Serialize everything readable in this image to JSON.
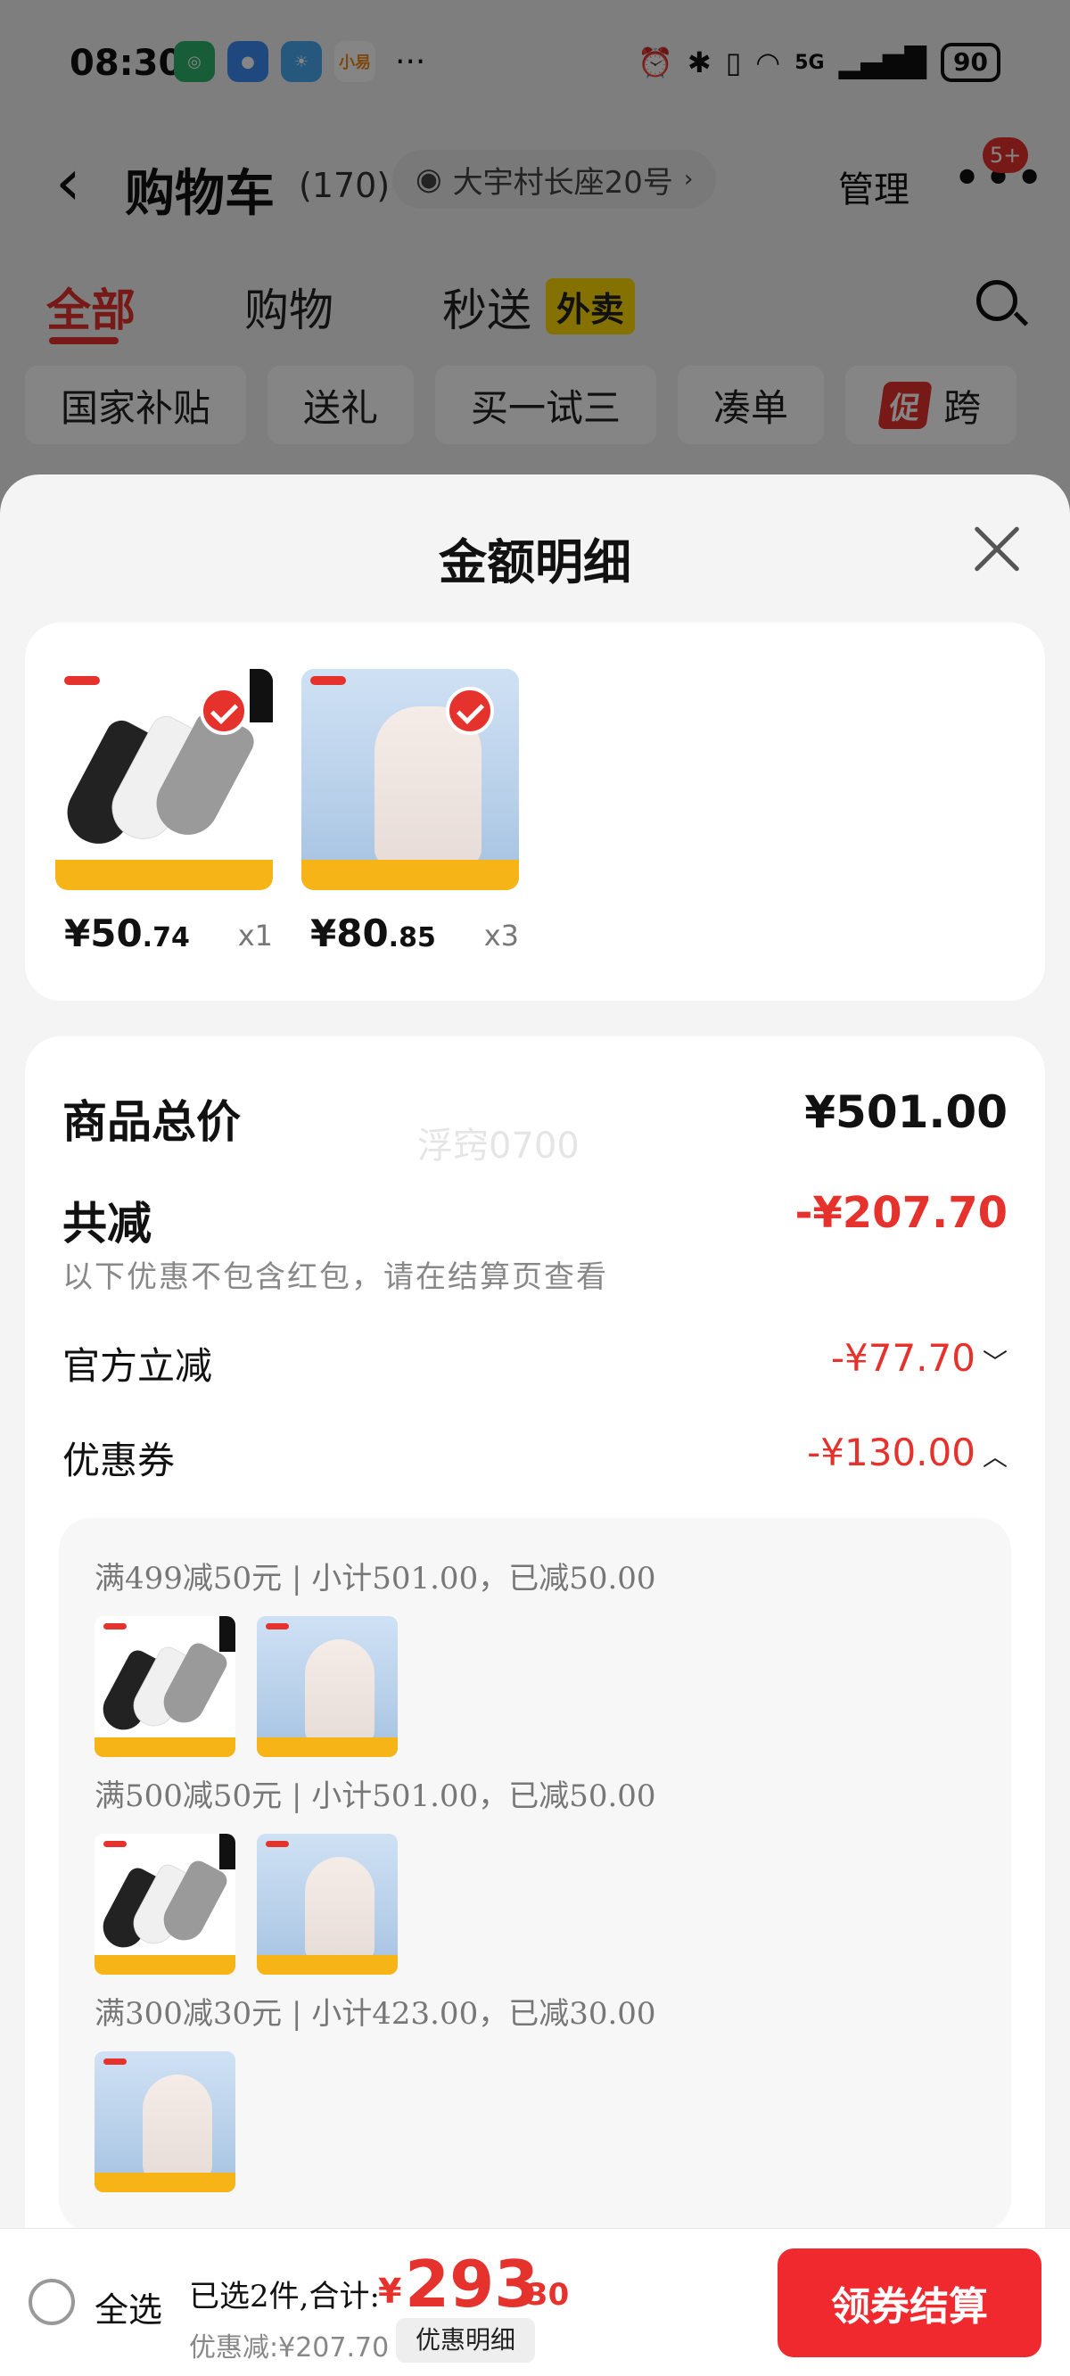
{
  "status_bar": {
    "time": "08:30",
    "app_icons": [
      "mobile-service-icon",
      "messages-icon",
      "weather-icon",
      "xiaoyi-icon"
    ],
    "app_icon_text": "小易",
    "more_dots": "···",
    "network": "5G",
    "battery": "90"
  },
  "nav": {
    "back_icon": "back-chevron-icon",
    "title": "购物车",
    "count": "(170)",
    "address": "大宇村长座20号",
    "manage": "管理",
    "more": "•••",
    "badge": "5+"
  },
  "tabs": [
    {
      "label": "全部",
      "active": true
    },
    {
      "label": "购物",
      "active": false
    },
    {
      "label": "秒送",
      "active": false
    }
  ],
  "tab_tag": "外卖",
  "chips": [
    "国家补贴",
    "送礼",
    "买一试三",
    "凑单",
    "跨"
  ],
  "chip_promo": "促",
  "sheet": {
    "title": "金额明细",
    "products": [
      {
        "price_int": "¥50",
        "price_dec": ".74",
        "qty": "x1",
        "thumb": "socks"
      },
      {
        "price_int": "¥80",
        "price_dec": ".85",
        "qty": "x3",
        "thumb": "jacket"
      }
    ],
    "summary": {
      "total_label": "商品总价",
      "total_value": "¥501.00",
      "watermark": "浮窍0700",
      "reduce_label": "共减",
      "reduce_value": "-¥207.70",
      "reduce_note": "以下优惠不包含红包，请在结算页查看",
      "official_label": "官方立减",
      "official_value": "-¥77.70",
      "coupon_label": "优惠券",
      "coupon_value": "-¥130.00"
    },
    "coupons": [
      {
        "text": "满499减50元 | 小计501.00，已减50.00",
        "items": [
          "socks",
          "jacket"
        ]
      },
      {
        "text": "满500减50元 | 小计501.00，已减50.00",
        "items": [
          "socks",
          "jacket"
        ]
      },
      {
        "text": "满300减30元 | 小计423.00，已减30.00",
        "items": [
          "jacket"
        ]
      }
    ]
  },
  "bottom": {
    "select_all": "全选",
    "selected_info": "已选2件,合计:",
    "yen": "¥",
    "total_int": "293",
    "total_dec": ".30",
    "discount": "优惠减:¥207.70",
    "detail_button": "优惠明细",
    "checkout_button": "领券结算"
  },
  "colors": {
    "accent": "#e5322d",
    "checkout": "#f0292f",
    "waimai_tag": "#ffd800"
  }
}
